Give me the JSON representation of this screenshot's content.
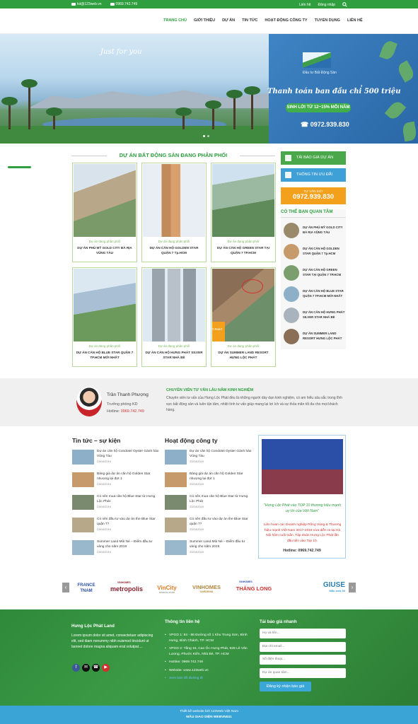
{
  "topbar": {
    "email": "kd@123web.vn",
    "phone": "0969.742.749",
    "login": "Liên hệ",
    "register": "Đăng nhập"
  },
  "nav": [
    "TRANG CHỦ",
    "GIỚI THIỆU",
    "DỰ ÁN",
    "TIN TỨC",
    "HOẠT ĐỘNG CÔNG TY",
    "TUYỂN DỤNG",
    "LIÊN HỆ"
  ],
  "hero": {
    "script": "Just for you",
    "brand": "Đầu tư Bất Động Sản",
    "headline": "Thanh toán ban đầu chỉ 500 triệu",
    "profit": "SINH LỜI TỪ 12~15% MỖI NĂM",
    "phone": "0972.939.830"
  },
  "projects": {
    "title": "DỰ ÁN BẤT ĐỘNG SẢN ĐANG PHÂN PHỐI",
    "tag": "Dự án đang phân phối",
    "items": [
      "DỰ ÁN PHÚ MỸ GOLD CITY BÀ RỊA VŨNG TÀU",
      "DỰ ÁN CĂN HỘ GOLDEN STAR QUẬN 7 Tp.HCM",
      "DỰ ÁN CĂN HỘ GREEN STAR TẠI QUẬN 7 TP.HCM",
      "DỰ ÁN CĂN HỘ BLUE STAR QUẬN 7 TP.HCM MỚI NHẤT",
      "DỰ ÁN CĂN HỘ HƯNG PHÁT SILVER STAR NHÀ BÈ",
      "DỰ ÁN SUMMER LAND RESORT HƯNG LỘC PHÁT"
    ],
    "overlay_text": "T PHÁT"
  },
  "sidebar": {
    "price_btn": "TẢI BÁO GIÁ DỰ ÁN",
    "offer_btn": "THÔNG TIN ƯU ĐÃI",
    "hotline_label": "TƯ VẤN 24/7",
    "hotline": "0972.939.830",
    "care_title": "CÓ THỂ BẠN QUAN TÂM",
    "care": [
      "DỰ ÁN PHÚ MỸ GOLD CITY BÀ RỊA VŨNG TÀU",
      "DỰ ÁN CĂN HỘ GOLDEN STAR QUẬN 7 Tp.HCM",
      "DỰ ÁN CĂN HỘ GREEN STAR TẠI QUẬN 7 TP.HCM",
      "DỰ ÁN CĂN HỘ BLUE STAR QUẬN 7 TP.HCM MỚI NHẤT",
      "DỰ ÁN CĂN HỘ HƯNG PHÁT SILVER STAR NHÀ BÈ",
      "DỰ ÁN SUMMER LAND RESORT HƯNG LỘC PHÁT"
    ]
  },
  "consultant": {
    "name": "Trần Thanh Phượng",
    "role": "Trưởng phòng KD",
    "hotline_label": "Hotline:",
    "hotline": "0969.742.749",
    "heading": "CHUYÊN VIÊN TƯ VẤN LÂU NĂM KINH NGHIỆM",
    "body": "Chuyên viên tư vấn của Hưng Lộc Phát đều là những người dày dạn kinh nghiệm, có am hiểu sâu sắc trong lĩnh vực bất động sản và luôn tận tâm, nhiệt tình tư vấn giúp mang lại lợi ích và sự thỏa mãn tối đa cho mọi khách hàng."
  },
  "news": {
    "title": "Tin tức – sự kiện",
    "items": [
      {
        "t": "Dự án căn hộ Condotel Oyster Gành hào Vũng Tàu",
        "d": "23/04/2019"
      },
      {
        "t": "Bảng giá dự án căn hộ Golden Star nhượng lại đợt 1",
        "d": "23/04/2019"
      },
      {
        "t": "Có nên mua căn hộ Blue Star từ Hưng Lộc Phát",
        "d": "23/04/2019"
      },
      {
        "t": "Có nên đầu tư vào dự án the Blue Star quận 7?",
        "d": "23/04/2019"
      },
      {
        "t": "Summer Land Mũi Né – Điểm đầu tư vàng cho năm 2019",
        "d": "23/04/2019"
      }
    ]
  },
  "activity": {
    "title": "Hoạt động công ty",
    "items": [
      {
        "t": "Dự án căn hộ Condotel Oyster Gành hào Vũng Tàu",
        "d": "23/04/2019"
      },
      {
        "t": "Bảng giá dự án căn hộ Golden Star nhượng lại đợt 1",
        "d": "23/04/2019"
      },
      {
        "t": "Có nên mua căn hộ Blue Star từ Hưng Lộc Phát",
        "d": "23/04/2019"
      },
      {
        "t": "Có nên đầu tư vào dự án the Blue Star quận 7?",
        "d": "23/04/2019"
      },
      {
        "t": "Summer Land Mũi Né – Điểm đầu tư vàng cho năm 2019",
        "d": "23/04/2019"
      }
    ]
  },
  "award": {
    "quote": "\"Hưng Lộc Phát vào TOP 10 thương hiệu mạnh uy tín của Việt Nam\"",
    "desc": "Liên hoan các Doanh nghiệp Rồng Vàng & Thương hiệu mạnh Việt Nam 2017-2018 vừa diễn ra tại Hà Nội hôm cuối tuần. Tập đoàn Hưng Lộc Phát lần đầu tiên vào Top 10.",
    "hotline": "Hotline: 0969.742.749"
  },
  "partners": [
    "FRANCE TNAM",
    "metropolis",
    "VinCity",
    "VINHOMES",
    "THĂNG LONG",
    "GIUSE"
  ],
  "partner_sub": {
    "metropolis": "VINHOMES",
    "vincity": "SPORTIA PARK",
    "vinhomes": "GARDENIA",
    "thanglong": "VINHOMES",
    "giuse": "Mẫu web 90"
  },
  "footer": {
    "brand": "Hưng Lộc Phát Land",
    "about": "Lorem ipsum dolor sit amet, consectetuer adipiscing elit, sed diam nonummy nibh euismod tincidunt ut laoreet dolore magna aliquam erat volutpat....",
    "info_title": "Thông tin liên hệ",
    "info": [
      "VPGD 1: 84 - 86 Đường số 1 Khu Trung Sơn, Bình Hưng, Bình Chánh, TP. HCM",
      "VPGD 2: Tầng 15, Cao Ốc Hưng Phát, 928 Lê Văn Lương, Phước Kiển, Nhà Bè, TP. HCM",
      "Hotline: 0969.742.749",
      "Website: www.123web.vn",
      "Xem bản đồ đường đi"
    ],
    "form_title": "Tải báo giá nhanh",
    "placeholders": [
      "Họ và tên...",
      "Địa chỉ email...",
      "Số điện thoại...",
      "Dự án quan tâm..."
    ],
    "submit": "Đăng ký nhận báo giá"
  },
  "bottom": {
    "line1": "Thiết kế website bởi 123Web Việt Nam",
    "line2": "MẪU GIAO DIỆN WEBVN041"
  },
  "colors": {
    "green": "#2e9e3e",
    "orange": "#f3a01c",
    "blue": "#3aa4d6",
    "red": "#d0312d"
  }
}
